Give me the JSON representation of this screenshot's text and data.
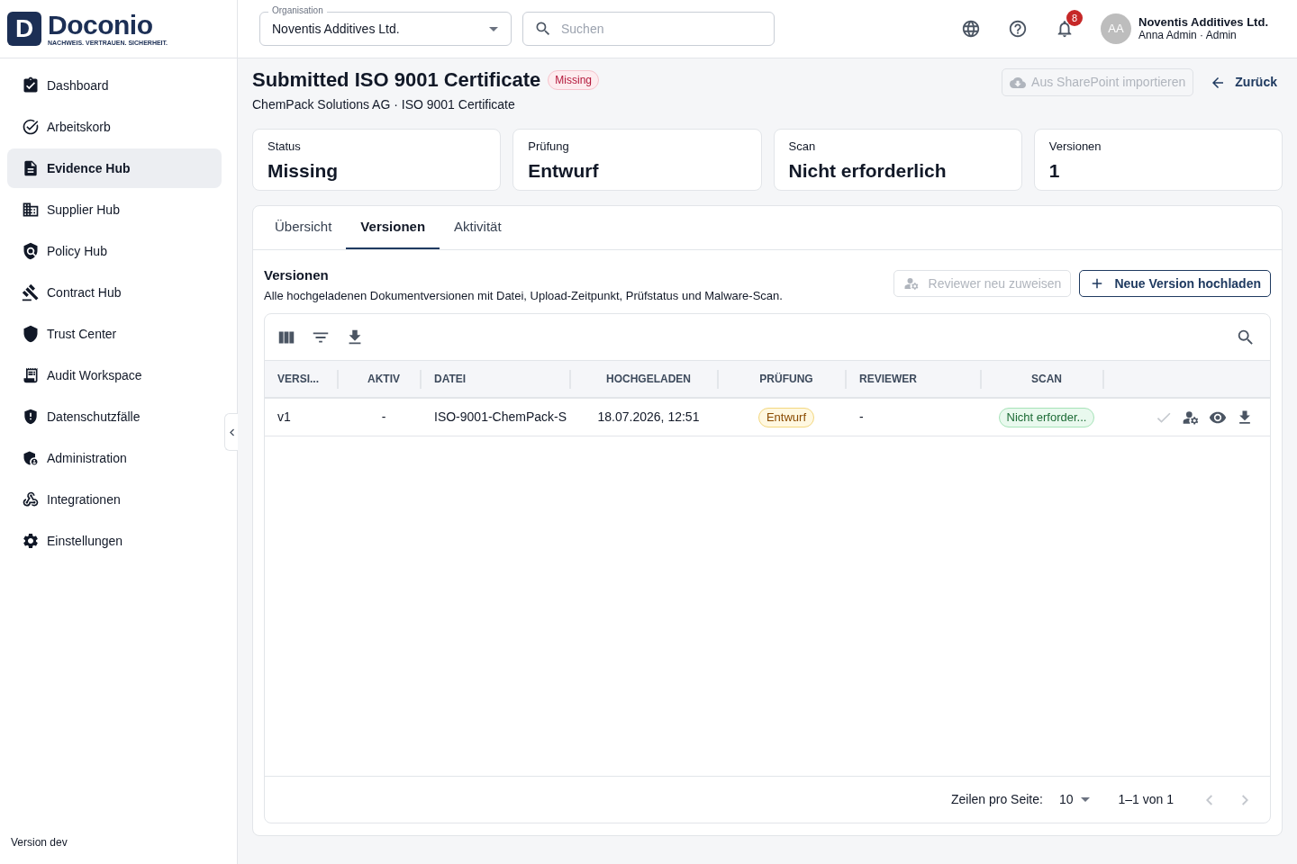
{
  "brand": {
    "mark": "D",
    "name": "Doconio",
    "tagline": "NACHWEIS. VERTRAUEN. SICHERHEIT."
  },
  "sidebar": {
    "items": [
      {
        "label": "Dashboard",
        "selected": false
      },
      {
        "label": "Arbeitskorb",
        "selected": false
      },
      {
        "label": "Evidence Hub",
        "selected": true
      },
      {
        "label": "Supplier Hub",
        "selected": false
      },
      {
        "label": "Policy Hub",
        "selected": false
      },
      {
        "label": "Contract Hub",
        "selected": false
      },
      {
        "label": "Trust Center",
        "selected": false
      },
      {
        "label": "Audit Workspace",
        "selected": false
      },
      {
        "label": "Datenschutzfälle",
        "selected": false
      },
      {
        "label": "Administration",
        "selected": false
      },
      {
        "label": "Integrationen",
        "selected": false
      },
      {
        "label": "Einstellungen",
        "selected": false
      }
    ],
    "version": "Version dev"
  },
  "topbar": {
    "organisation": {
      "label": "Organisation",
      "value": "Noventis Additives Ltd."
    },
    "search": {
      "placeholder": "Suchen"
    },
    "notifications": {
      "count": "8"
    },
    "user": {
      "initials": "AA",
      "organisation": "Noventis Additives Ltd.",
      "name": "Anna Admin · Admin"
    }
  },
  "page": {
    "title": "Submitted ISO 9001 Certificate",
    "status_badge": "Missing",
    "subtitle": "ChemPack Solutions AG · ISO 9001 Certificate",
    "import_button": {
      "label": "Aus SharePoint importieren",
      "disabled": true
    },
    "back_link": "Zurück"
  },
  "stats": [
    {
      "label": "Status",
      "value": "Missing"
    },
    {
      "label": "Prüfung",
      "value": "Entwurf"
    },
    {
      "label": "Scan",
      "value": "Nicht erforderlich"
    },
    {
      "label": "Versionen",
      "value": "1"
    }
  ],
  "tabs": [
    {
      "label": "Übersicht",
      "selected": false
    },
    {
      "label": "Versionen",
      "selected": true
    },
    {
      "label": "Aktivität",
      "selected": false
    }
  ],
  "versions": {
    "title": "Versionen",
    "description": "Alle hochgeladenen Dokumentversionen mit Datei, Upload-Zeitpunkt, Prüfstatus und Malware-Scan.",
    "buttons": [
      {
        "kind": "reassign",
        "label": "Reviewer neu zuweisen",
        "disabled": true
      },
      {
        "kind": "upload",
        "label": "Neue Version hochladen",
        "disabled": false
      }
    ],
    "table": {
      "columns": [
        "VERSI...",
        "AKTIV",
        "DATEI",
        "HOCHGELADEN",
        "PRÜFUNG",
        "REVIEWER",
        "SCAN"
      ],
      "rows": [
        {
          "version": "v1",
          "active": "-",
          "file": "ISO-9001-ChemPack-S",
          "uploaded": "18.07.2026, 12:51",
          "review": "Entwurf",
          "reviewer": "-",
          "scan": "Nicht erforder...",
          "actions": [
            {
              "kind": "approve",
              "disabled": true
            },
            {
              "kind": "assign",
              "disabled": false
            },
            {
              "kind": "view",
              "disabled": false
            },
            {
              "kind": "download",
              "disabled": false
            }
          ]
        }
      ]
    },
    "pagination": {
      "rows_per_page_label": "Zeilen pro Seite:",
      "rows_per_page": "10",
      "range": "1–1 von 1",
      "previous_disabled": true,
      "next_disabled": true
    }
  }
}
